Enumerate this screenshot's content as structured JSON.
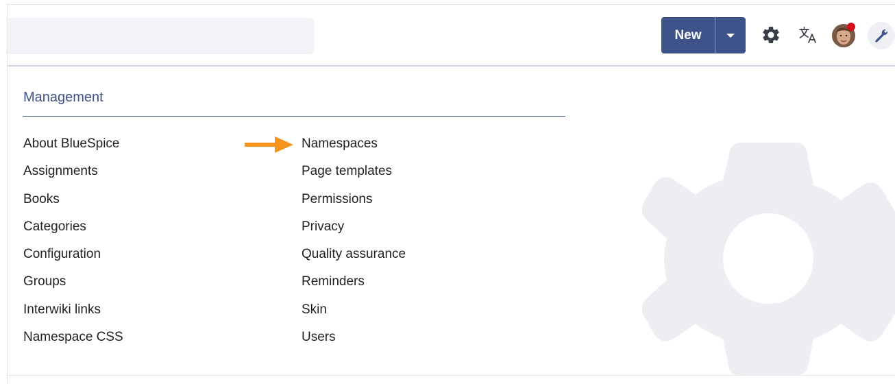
{
  "header": {
    "new_label": "New"
  },
  "icons": {
    "settings": "gear-icon",
    "language": "translate-icon",
    "user": "avatar",
    "admin": "wrench-icon"
  },
  "colors": {
    "accent": "#3e5389",
    "notification": "#d40f1c",
    "arrow": "#f7941d",
    "watermark": "#eceef4"
  },
  "management": {
    "title": "Management",
    "left_items": [
      "About BlueSpice",
      "Assignments",
      "Books",
      "Categories",
      "Configuration",
      "Groups",
      "Interwiki links",
      "Namespace CSS"
    ],
    "right_items": [
      "Namespaces",
      "Page templates",
      "Permissions",
      "Privacy",
      "Quality assurance",
      "Reminders",
      "Skin",
      "Users"
    ]
  }
}
